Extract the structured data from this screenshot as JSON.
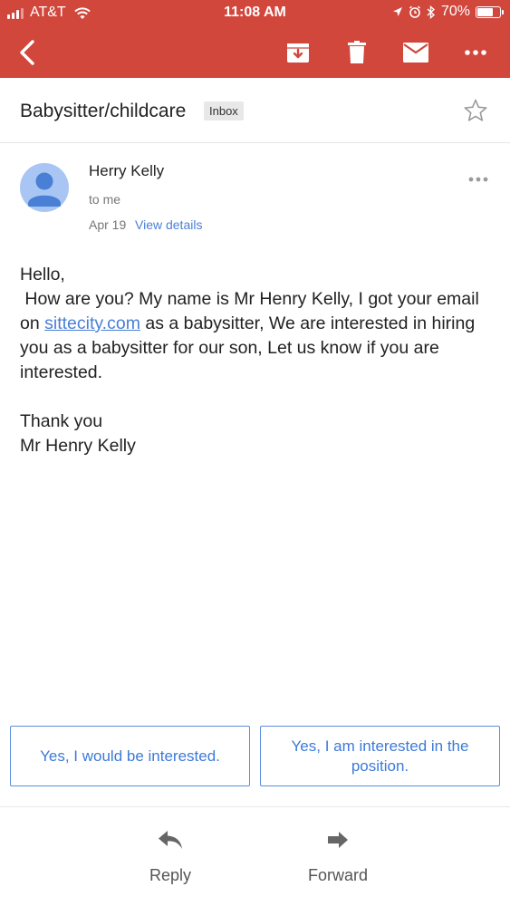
{
  "status_bar": {
    "carrier": "AT&T",
    "time": "11:08 AM",
    "battery": "70%",
    "battery_level": 0.7
  },
  "toolbar": {
    "back_icon": "back-arrow-icon",
    "archive_icon": "archive-icon",
    "delete_icon": "trash-icon",
    "mark_unread_icon": "mail-icon",
    "more_icon": "more-horizontal-icon"
  },
  "email": {
    "subject": "Babysitter/childcare",
    "label": "Inbox",
    "sender": "Herry Kelly",
    "recipient": "to me",
    "date": "Apr 19",
    "view_details": "View details",
    "body": {
      "greeting": "Hello,",
      "line_start": " How are you? My name is Mr Henry Kelly, I got your email on ",
      "link": "sittecity.com",
      "line_end": " as a babysitter, We are interested in hiring you as a babysitter for our son, Let us know if you are interested.",
      "closing": "Thank you",
      "signature": "Mr Henry Kelly"
    }
  },
  "smart_replies": [
    "Yes, I would be interested.",
    "Yes, I am interested in the position."
  ],
  "actions": {
    "reply": "Reply",
    "forward": "Forward"
  },
  "colors": {
    "header": "#d1473c",
    "link": "#4a7fd6",
    "avatar_bg": "#a8c5f4",
    "avatar_fg": "#4a7fd6"
  }
}
